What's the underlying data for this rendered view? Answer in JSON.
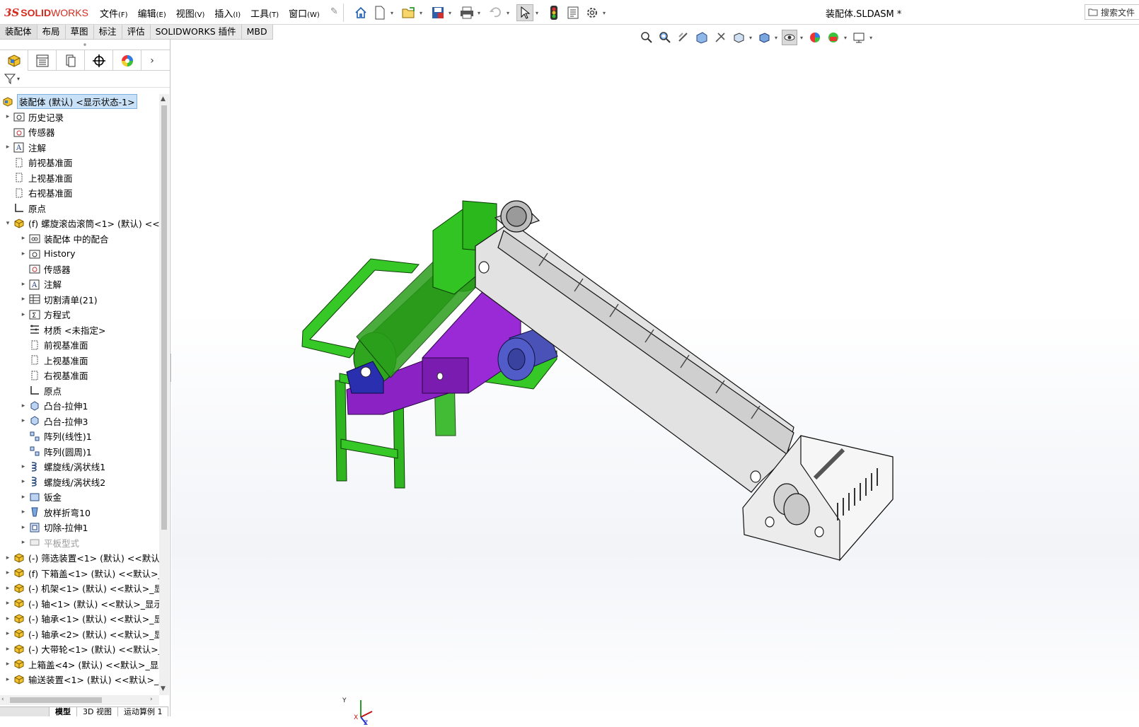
{
  "app": {
    "logo_prefix": "3S",
    "logo_brand_bold": "SOLID",
    "logo_brand": "WORKS",
    "brand_color": "#d52b1e"
  },
  "menu": [
    {
      "label": "文件",
      "accel": "(F)"
    },
    {
      "label": "编辑",
      "accel": "(E)"
    },
    {
      "label": "视图",
      "accel": "(V)"
    },
    {
      "label": "插入",
      "accel": "(I)"
    },
    {
      "label": "工具",
      "accel": "(T)"
    },
    {
      "label": "窗口",
      "accel": "(W)"
    }
  ],
  "quick_access_icons": [
    "home-icon",
    "new-icon",
    "open-icon",
    "save-icon",
    "print-icon",
    "undo-icon",
    "select-icon",
    "rebuild-icon",
    "file-properties-icon",
    "options-icon"
  ],
  "document_title": "装配体.SLDASM *",
  "search": {
    "label": "搜索文件"
  },
  "command_tabs": [
    "装配体",
    "布局",
    "草图",
    "标注",
    "评估",
    "SOLIDWORKS 插件",
    "MBD"
  ],
  "view_toolbar_icons": [
    "zoom-to-fit-icon",
    "zoom-to-area-icon",
    "previous-view-icon",
    "section-view-icon",
    "dynamic-annotation-icon",
    "view-orientation-icon",
    "display-style-icon",
    "hide-show-icon",
    "edit-appearance-icon",
    "apply-scene-icon",
    "view-settings-icon"
  ],
  "panel_tabs": [
    "featuremanager-tab-icon",
    "propertymanager-tab-icon",
    "configurationmanager-tab-icon",
    "dimxpert-tab-icon",
    "displaymanager-tab-icon"
  ],
  "tree": [
    {
      "label": "装配体 (默认) <显示状态-1>",
      "indent": 0,
      "expander": "",
      "icon": "assembly",
      "kind": "root"
    },
    {
      "label": "历史记录",
      "indent": 1,
      "expander": "▸",
      "icon": "history"
    },
    {
      "label": "传感器",
      "indent": 1,
      "expander": "",
      "icon": "sensor"
    },
    {
      "label": "注解",
      "indent": 1,
      "expander": "▸",
      "icon": "annotation"
    },
    {
      "label": "前视基准面",
      "indent": 1,
      "expander": "",
      "icon": "plane"
    },
    {
      "label": "上视基准面",
      "indent": 1,
      "expander": "",
      "icon": "plane"
    },
    {
      "label": "右视基准面",
      "indent": 1,
      "expander": "",
      "icon": "plane"
    },
    {
      "label": "原点",
      "indent": 1,
      "expander": "",
      "icon": "origin"
    },
    {
      "label": "(f) 螺旋滚齿滚筒<1> (默认) <<默",
      "indent": 1,
      "expander": "▾",
      "icon": "part"
    },
    {
      "label": "装配体 中的配合",
      "indent": 2,
      "expander": "▸",
      "icon": "mates"
    },
    {
      "label": "History",
      "indent": 2,
      "expander": "▸",
      "icon": "history"
    },
    {
      "label": "传感器",
      "indent": 2,
      "expander": "",
      "icon": "sensor"
    },
    {
      "label": "注解",
      "indent": 2,
      "expander": "▸",
      "icon": "annotation"
    },
    {
      "label": "切割清单(21)",
      "indent": 2,
      "expander": "▸",
      "icon": "cutlist"
    },
    {
      "label": "方程式",
      "indent": 2,
      "expander": "▸",
      "icon": "equation"
    },
    {
      "label": "材质 <未指定>",
      "indent": 2,
      "expander": "",
      "icon": "material"
    },
    {
      "label": "前视基准面",
      "indent": 2,
      "expander": "",
      "icon": "plane"
    },
    {
      "label": "上视基准面",
      "indent": 2,
      "expander": "",
      "icon": "plane"
    },
    {
      "label": "右视基准面",
      "indent": 2,
      "expander": "",
      "icon": "plane"
    },
    {
      "label": "原点",
      "indent": 2,
      "expander": "",
      "icon": "origin"
    },
    {
      "label": "凸台-拉伸1",
      "indent": 2,
      "expander": "▸",
      "icon": "extrude"
    },
    {
      "label": "凸台-拉伸3",
      "indent": 2,
      "expander": "▸",
      "icon": "extrude"
    },
    {
      "label": "阵列(线性)1",
      "indent": 2,
      "expander": "",
      "icon": "pattern"
    },
    {
      "label": "阵列(圆周)1",
      "indent": 2,
      "expander": "",
      "icon": "pattern"
    },
    {
      "label": "螺旋线/涡状线1",
      "indent": 2,
      "expander": "▸",
      "icon": "helix"
    },
    {
      "label": "螺旋线/涡状线2",
      "indent": 2,
      "expander": "▸",
      "icon": "helix"
    },
    {
      "label": "钣金",
      "indent": 2,
      "expander": "▸",
      "icon": "sheetmetal"
    },
    {
      "label": "放样折弯10",
      "indent": 2,
      "expander": "▸",
      "icon": "loftbend"
    },
    {
      "label": "切除-拉伸1",
      "indent": 2,
      "expander": "▸",
      "icon": "cut"
    },
    {
      "label": "平板型式",
      "indent": 2,
      "expander": "▸",
      "icon": "flat",
      "kind": "disabled"
    },
    {
      "label": "(-) 筛选装置<1> (默认) <<默认",
      "indent": 1,
      "expander": "▸",
      "icon": "part"
    },
    {
      "label": "(f) 下箱盖<1> (默认) <<默认>_",
      "indent": 1,
      "expander": "▸",
      "icon": "part"
    },
    {
      "label": "(-) 机架<1> (默认) <<默认>_显",
      "indent": 1,
      "expander": "▸",
      "icon": "part"
    },
    {
      "label": "(-) 轴<1> (默认) <<默认>_显示",
      "indent": 1,
      "expander": "▸",
      "icon": "part"
    },
    {
      "label": "(-) 轴承<1> (默认) <<默认>_显",
      "indent": 1,
      "expander": "▸",
      "icon": "part"
    },
    {
      "label": "(-) 轴承<2> (默认) <<默认>_显",
      "indent": 1,
      "expander": "▸",
      "icon": "part"
    },
    {
      "label": "(-) 大带轮<1> (默认) <<默认>_",
      "indent": 1,
      "expander": "▸",
      "icon": "part"
    },
    {
      "label": "上箱盖<4> (默认) <<默认>_显示",
      "indent": 1,
      "expander": "▸",
      "icon": "part"
    },
    {
      "label": "输送装置<1> (默认) <<默认>_显",
      "indent": 1,
      "expander": "▸",
      "icon": "part"
    }
  ],
  "bottom_tabs": [
    "",
    "模型",
    "3D 视图",
    "运动算例 1"
  ],
  "triad": {
    "y_label": "Y",
    "x_label": "X",
    "z_label": "Z"
  },
  "colors": {
    "frame_green": "#31c423",
    "hopper_purple": "#8a22c4",
    "motor_blue": "#4a52b8",
    "conveyor_gray": "#e2e2e2",
    "selection_blue": "#c9e1f7"
  }
}
